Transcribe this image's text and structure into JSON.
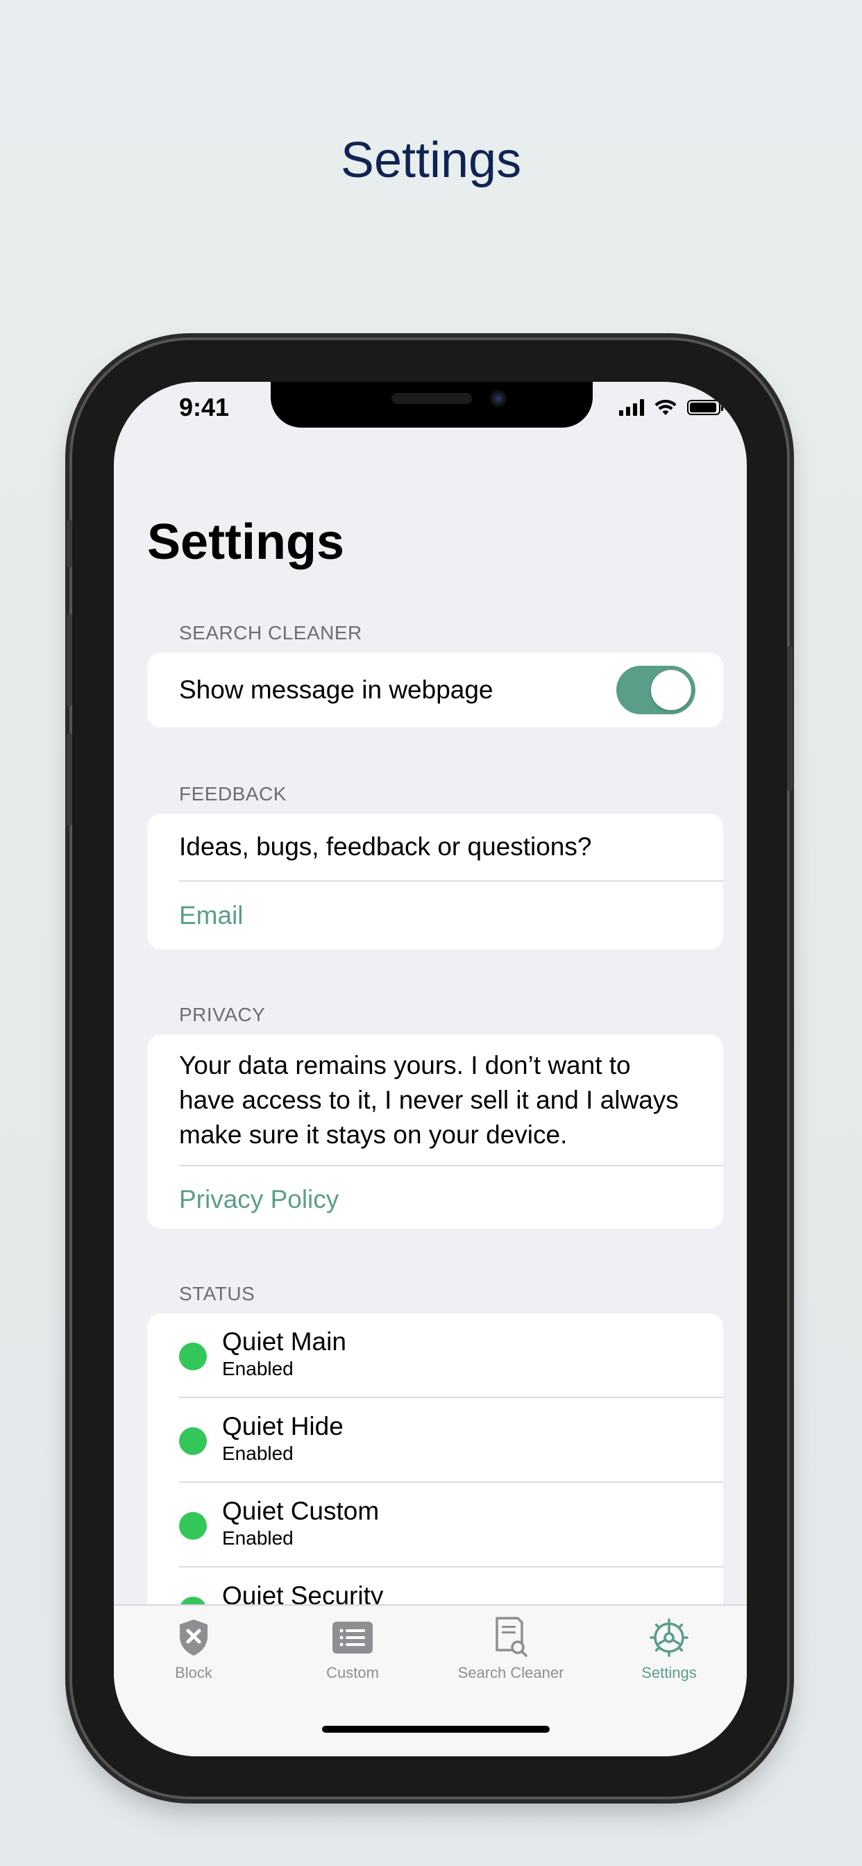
{
  "promo": {
    "title": "Settings"
  },
  "status_bar": {
    "time": "9:41"
  },
  "page": {
    "title": "Settings"
  },
  "sections": {
    "search_cleaner": {
      "header": "SEARCH CLEANER",
      "toggle_label": "Show message in webpage",
      "toggle_on": true
    },
    "feedback": {
      "header": "FEEDBACK",
      "prompt": "Ideas, bugs, feedback or questions?",
      "link": "Email"
    },
    "privacy": {
      "header": "PRIVACY",
      "text": "Your data remains yours. I don’t want to have access to it, I never sell it and I always make sure it stays on your device.",
      "link": "Privacy Policy"
    },
    "status": {
      "header": "STATUS",
      "items": [
        {
          "name": "Quiet Main",
          "state": "Enabled"
        },
        {
          "name": "Quiet Hide",
          "state": "Enabled"
        },
        {
          "name": "Quiet Custom",
          "state": "Enabled"
        },
        {
          "name": "Quiet Security",
          "state": ""
        }
      ]
    }
  },
  "tabbar": {
    "tabs": [
      {
        "label": "Block",
        "icon": "shield-x-icon"
      },
      {
        "label": "Custom",
        "icon": "list-icon"
      },
      {
        "label": "Search Cleaner",
        "icon": "document-search-icon"
      },
      {
        "label": "Settings",
        "icon": "gear-icon"
      }
    ],
    "active": "Settings"
  },
  "colors": {
    "accent": "#5a9e8a",
    "status_green": "#33c759",
    "promo_title": "#0f2453"
  }
}
